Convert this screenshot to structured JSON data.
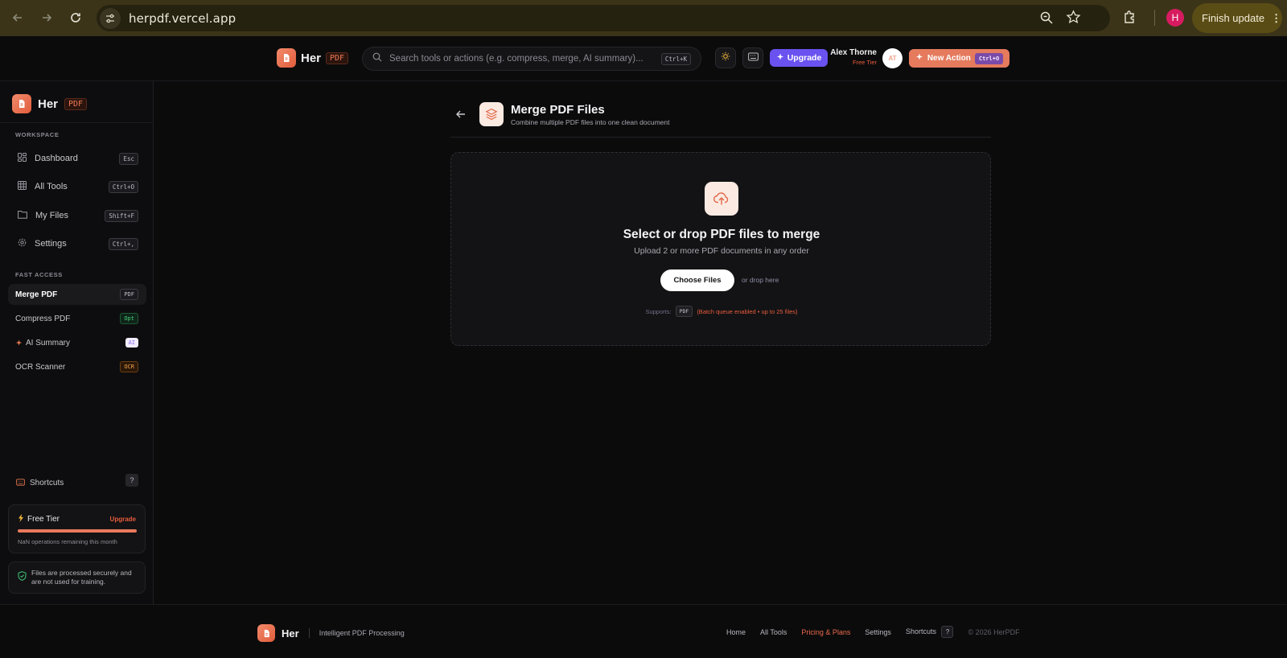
{
  "browser": {
    "url": "herpdf.vercel.app",
    "profile_initial": "H",
    "finish_update_label": "Finish update"
  },
  "header": {
    "brand": "Her",
    "brand_tag": "PDF",
    "search_placeholder": "Search tools or actions (e.g. compress, merge, AI summary)...",
    "search_shortcut": "Ctrl+K",
    "upgrade_label": "Upgrade",
    "user_name": "Alex Thorne",
    "user_tier": "Free Tier",
    "avatar_initials": "AT",
    "new_action_label": "New Action",
    "new_action_shortcut": "Ctrl+O"
  },
  "sidebar": {
    "brand": "Her",
    "brand_tag": "PDF",
    "workspace_label": "WORKSPACE",
    "workspace_items": [
      {
        "label": "Dashboard",
        "shortcut": "Esc",
        "icon": "dashboard-icon"
      },
      {
        "label": "All Tools",
        "shortcut": "Ctrl+O",
        "icon": "grid-icon"
      },
      {
        "label": "My Files",
        "shortcut": "Shift+F",
        "icon": "folder-icon"
      },
      {
        "label": "Settings",
        "shortcut": "Ctrl+,",
        "icon": "gear-icon"
      }
    ],
    "fast_access_label": "FAST ACCESS",
    "fast_items": [
      {
        "label": "Merge PDF",
        "badge": "PDF",
        "active": true
      },
      {
        "label": "Compress PDF",
        "badge": "Opt"
      },
      {
        "label": "AI Summary",
        "badge": "AI"
      },
      {
        "label": "OCR Scanner",
        "badge": "OCR"
      }
    ],
    "shortcuts_label": "Shortcuts",
    "shortcuts_key": "?",
    "tier_card": {
      "title": "Free Tier",
      "upgrade": "Upgrade",
      "progress": 1.0,
      "ops_text": "NaN operations remaining this month"
    },
    "secure_text": "Files are processed securely and are not used for training."
  },
  "main": {
    "title": "Merge PDF Files",
    "subtitle": "Combine multiple PDF files into one clean document",
    "dropzone": {
      "title": "Select or drop PDF files to merge",
      "subtitle": "Upload 2 or more PDF documents in any order",
      "choose_label": "Choose Files",
      "drop_hint": "or drop here",
      "supports_label": "Supports:",
      "supports_format": "PDF",
      "supports_note": "(Batch queue enabled • up to 25 files)"
    }
  },
  "footer": {
    "brand": "Her",
    "tagline": "Intelligent PDF Processing",
    "links": [
      "Home",
      "All Tools",
      "Pricing & Plans",
      "Settings",
      "Shortcuts"
    ],
    "shortcuts_key": "?",
    "copyright": "© 2026 HerPDF"
  },
  "colors": {
    "accent": "#e85c3c",
    "upgrade_purple": "#6a52f0",
    "background": "#0b0b0c"
  }
}
